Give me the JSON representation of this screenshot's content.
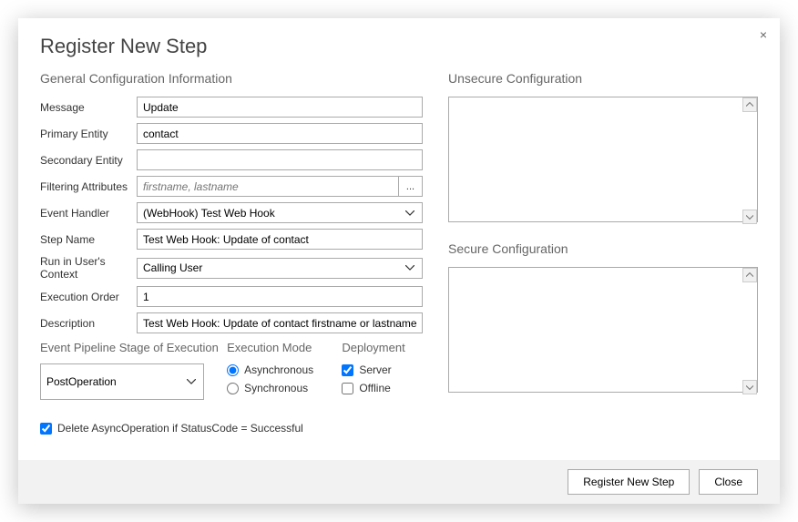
{
  "dialog": {
    "title": "Register New Step",
    "close_icon": "×"
  },
  "general": {
    "heading": "General Configuration Information",
    "labels": {
      "message": "Message",
      "primary_entity": "Primary Entity",
      "secondary_entity": "Secondary Entity",
      "filtering_attributes": "Filtering Attributes",
      "event_handler": "Event Handler",
      "step_name": "Step Name",
      "run_in_user_context": "Run in User's Context",
      "execution_order": "Execution Order",
      "description": "Description"
    },
    "values": {
      "message": "Update",
      "primary_entity": "contact",
      "secondary_entity": "",
      "filtering_attributes_placeholder": "firstname, lastname",
      "event_handler": "(WebHook) Test Web Hook",
      "step_name": "Test Web Hook: Update of contact",
      "run_in_user_context": "Calling User",
      "execution_order": "1",
      "description": "Test Web Hook: Update of contact firstname or lastname"
    },
    "filter_btn": "..."
  },
  "pipeline": {
    "heading": "Event Pipeline Stage of Execution",
    "value": "PostOperation"
  },
  "execution_mode": {
    "heading": "Execution Mode",
    "asynchronous": "Asynchronous",
    "synchronous": "Synchronous"
  },
  "deployment": {
    "heading": "Deployment",
    "server": "Server",
    "offline": "Offline"
  },
  "delete_async": {
    "label": "Delete AsyncOperation if StatusCode = Successful"
  },
  "unsecure": {
    "heading": "Unsecure  Configuration"
  },
  "secure": {
    "heading": "Secure  Configuration"
  },
  "footer": {
    "register": "Register New Step",
    "close": "Close"
  }
}
